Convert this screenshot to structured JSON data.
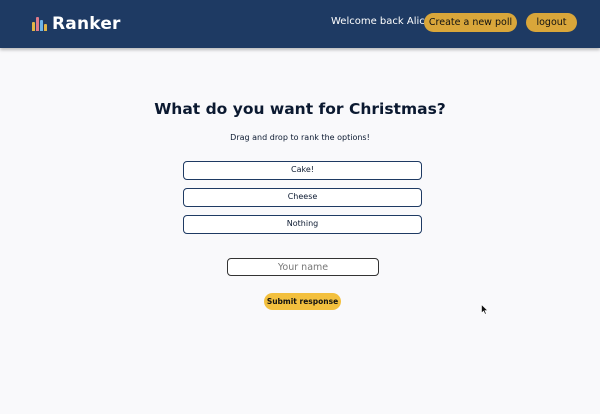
{
  "header": {
    "brand_name": "Ranker",
    "welcome_text": "Welcome back Alice!",
    "create_poll_label": "Create a new poll",
    "logout_label": "logout"
  },
  "poll": {
    "question": "What do you want for Christmas?",
    "instructions": "Drag and drop to rank the options!",
    "options": [
      {
        "label": "Cake!"
      },
      {
        "label": "Cheese"
      },
      {
        "label": "Nothing"
      }
    ]
  },
  "form": {
    "name_placeholder": "Your name",
    "name_value": "",
    "submit_label": "Submit response"
  },
  "icons": {
    "logo": "bar-chart-icon",
    "cursor": "mouse-pointer-icon"
  },
  "colors": {
    "header_bg": "#1e3a63",
    "accent_button": "#d9a63a",
    "submit_button": "#f3c03e",
    "logo_bars": [
      "#e2b547",
      "#e07a8a",
      "#6db5e8",
      "#e2b547"
    ]
  }
}
